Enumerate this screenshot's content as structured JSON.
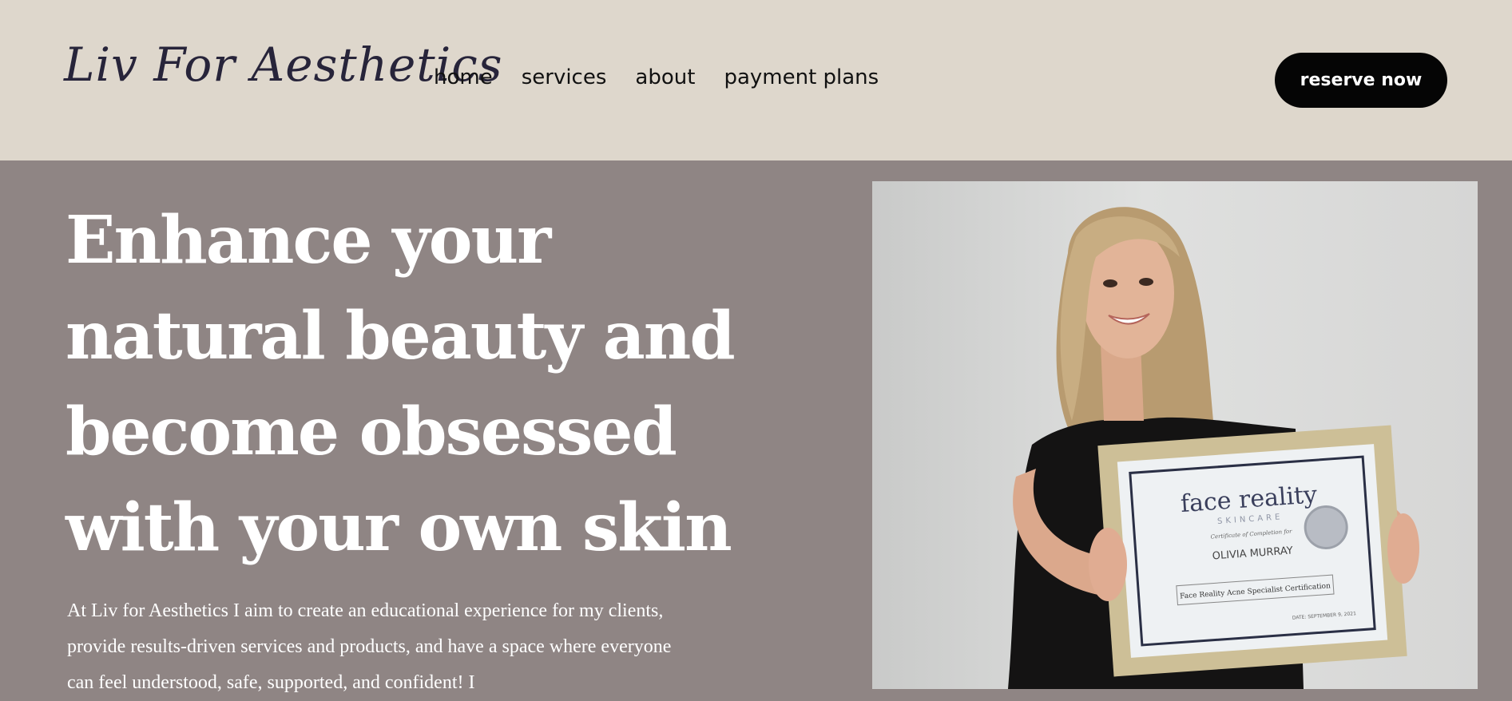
{
  "header": {
    "logo": "Liv For Aesthetics",
    "nav": [
      "home",
      "services",
      "about",
      "payment plans"
    ],
    "cta": "reserve now"
  },
  "hero": {
    "headline_lines": [
      "Enhance your",
      "natural beauty and",
      "become obsessed",
      "with your own skin"
    ],
    "intro": "At Liv for Aesthetics I aim to create an educational experience for my clients, provide results-driven services and products, and have a space where everyone can feel understood, safe, supported, and confident! I"
  },
  "photo": {
    "certificate": {
      "brand": "face reality",
      "brand_sub": "SKINCARE",
      "awarded_to": "Certificate of Completion for",
      "name": "OLIVIA MURRAY",
      "course": "Face Reality Acne Specialist Certification",
      "date": "DATE: SEPTEMBER 9, 2021"
    }
  },
  "colors": {
    "header_bg": "#ded7cc",
    "hero_bg": "#8f8584",
    "cta_bg": "#050505",
    "logo": "#27243a"
  }
}
